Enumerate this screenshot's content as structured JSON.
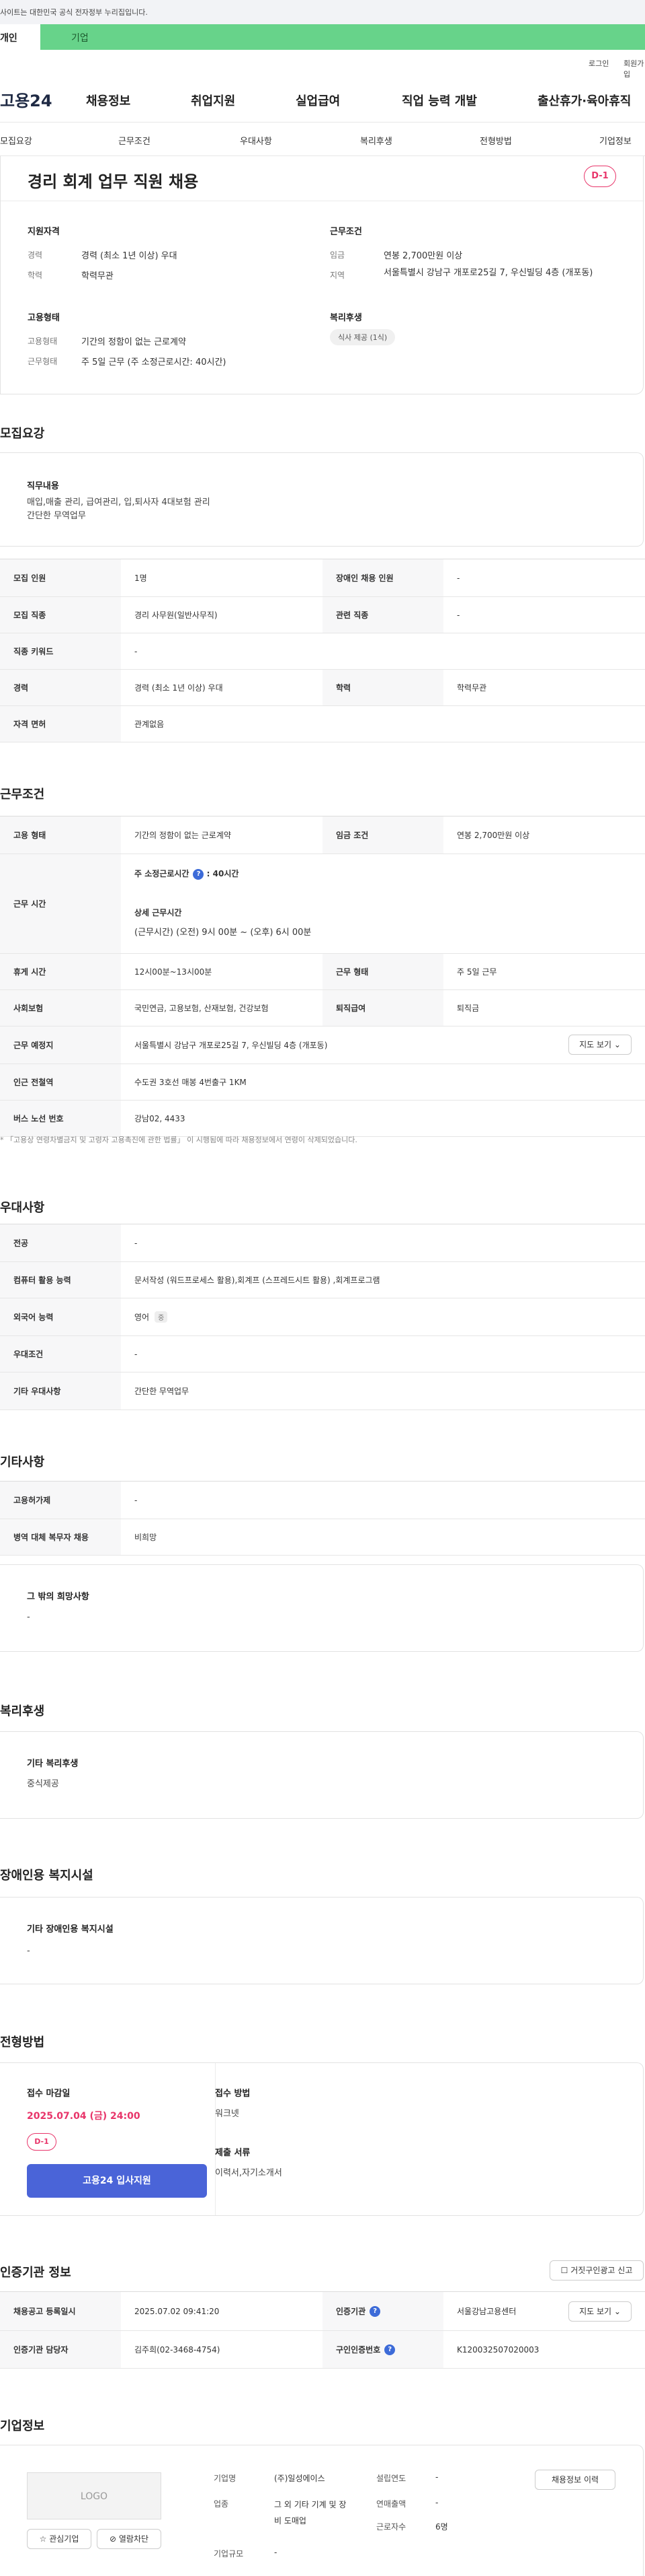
{
  "gov_banner": {
    "text": "사이트는 대한민국 공식 전자정부 누리집입니다."
  },
  "tabs": {
    "person": "개인",
    "company": "기업"
  },
  "util": {
    "login": "로그인",
    "join": "회원가입"
  },
  "gnb": {
    "logo": "고용24",
    "menus": [
      "채용정보",
      "취업지원",
      "실업급여",
      "직업 능력 개발",
      "출산휴가·육아휴직"
    ]
  },
  "subnav": [
    "모집요강",
    "근무조건",
    "우대사항",
    "복리후생",
    "전형방법",
    "기업정보"
  ],
  "header": {
    "job_title": "경리 회계 업무 직원 채용",
    "dday": "D-1"
  },
  "summary": {
    "qual_title": "지원자격",
    "qual": [
      {
        "k": "경력",
        "v": "경력 (최소 1년 이상) 우대"
      },
      {
        "k": "학력",
        "v": "학력무관"
      }
    ],
    "cond_title": "근무조건",
    "cond": [
      {
        "k": "임금",
        "v": "연봉 2,700만원 이상"
      },
      {
        "k": "지역",
        "v": "서울특별시 강남구 개포로25길 7, 우신빌딩 4층 (개포동)"
      }
    ],
    "emp_title": "고용형태",
    "emp": [
      {
        "k": "고용형태",
        "v": "기간의 정함이 없는 근로계약"
      },
      {
        "k": "근무형태",
        "v": "주 5일 근무 (주 소정근로시간: 40시간)"
      }
    ],
    "welfare_title": "복리후생",
    "welfare_chip": "식사 제공 (1식)"
  },
  "recruit": {
    "title": "모집요강",
    "duty_title": "직무내용",
    "duty_text": "매입,매출 관리, 급여관리, 입,퇴사자 4대보험 관리\n간단한 무역업무",
    "rows": [
      {
        "k1": "모집 인원",
        "v1": "1명",
        "k2": "장애인 채용 인원",
        "v2": "-"
      },
      {
        "k1": "모집 직종",
        "v1": "경리 사무원(일반사무직)",
        "k2": "관련 직종",
        "v2": "-"
      },
      {
        "k1": "직종 키워드",
        "v1": "-"
      },
      {
        "k1": "경력",
        "v1": "경력 (최소 1년 이상) 우대",
        "k2": "학력",
        "v2": "학력무관"
      },
      {
        "k1": "자격 면허",
        "v1": "관계없음"
      }
    ]
  },
  "conditions": {
    "title": "근무조건",
    "emp_type": {
      "k1": "고용 형태",
      "v1": "기간의 정함이 없는 근로계약",
      "k2": "임금 조건",
      "v2": "연봉 2,700만원 이상"
    },
    "hours": {
      "k": "근무 시간",
      "weekly_label": "주 소정근로시간",
      "weekly_value": ": 40시간",
      "detail_label": "상세 근무시간",
      "detail_value": "(근무시간) (오전) 9시 00분 ~ (오후) 6시 00분"
    },
    "rest": {
      "k1": "휴게 시간",
      "v1": "12시00분~13시00분",
      "k2": "근무 형태",
      "v2": "주 5일 근무"
    },
    "insurance": {
      "k1": "사회보험",
      "v1": "국민연금, 고용보험, 산재보험, 건강보험",
      "k2": "퇴직급여",
      "v2": "퇴직금"
    },
    "place": {
      "k": "근무 예정지",
      "v": "서울특별시 강남구 개포로25길 7, 우신빌딩 4층 (개포동)",
      "btn": "지도 보기"
    },
    "subway": {
      "k": "인근 전철역",
      "v": "수도권 3호선 매봉 4번출구 1KM"
    },
    "bus": {
      "k": "버스 노선 번호",
      "v": "강남02, 4433"
    },
    "note": "* 「고용상 연령차별금지 및 고령자 고용촉진에 관한 법률」 이 시행됨에 따라 채용정보에서 연령이 삭제되었습니다."
  },
  "preference": {
    "title": "우대사항",
    "rows": [
      {
        "k": "전공",
        "v": "-"
      },
      {
        "k": "컴퓨터 활용 능력",
        "v": "문서작성 (워드프로세스 활용),회계프 (스프레드시트 활용) ,회계프로그램"
      },
      {
        "k": "외국어 능력",
        "v": "영어",
        "badge": "중"
      },
      {
        "k": "우대조건",
        "v": "-"
      },
      {
        "k": "기타 우대사항",
        "v": "간단한 무역업무"
      }
    ]
  },
  "etc": {
    "title": "기타사항",
    "rows": [
      {
        "k": "고용허가제",
        "v": "-"
      },
      {
        "k": "병역 대체 복무자 채용",
        "v": "비희망"
      }
    ],
    "hope_title": "그 밖의 희망사항",
    "hope_text": "-"
  },
  "welfare": {
    "title": "복리후생",
    "box_title": "기타 복리후생",
    "box_text": "중식제공"
  },
  "disability": {
    "title": "장애인용 복지시설",
    "box_title": "기타 장애인용 복지시설",
    "box_text": "-"
  },
  "selection": {
    "title": "전형방법",
    "deadline_label": "접수 마감일",
    "deadline": "2025.07.04 (금) 24:00",
    "dday": "D-1",
    "apply": "고용24 입사지원",
    "method_label": "접수 방법",
    "method": "워크넷",
    "docs_label": "제출 서류",
    "docs": "이력서,자기소개서"
  },
  "cert": {
    "title": "인증기관 정보",
    "report_btn": "거짓구인광고 신고",
    "r1": {
      "k1": "채용공고 등록일시",
      "v1": "2025.07.02 09:41:20",
      "k2": "인증기관",
      "v2": "서울강남고용센터",
      "btn": "지도 보기"
    },
    "r2": {
      "k1": "인증기관 담당자",
      "v1": "김주희(02-3468-4754)",
      "k2": "구인인증번호",
      "v2": "K120032507020003"
    }
  },
  "company": {
    "title": "기업정보",
    "logo": "LOGO",
    "interest": "관심기업",
    "block": "열람차단",
    "history_btn": "채용정보 이력",
    "fields": [
      {
        "k": "기업명",
        "v": "(주)일성에이스"
      },
      {
        "k": "업종",
        "v": "그 외 기타 기계 및 장비 도매업"
      },
      {
        "k": "기업규모",
        "v": "-"
      }
    ],
    "fields2": [
      {
        "k": "설립연도",
        "v": "-"
      },
      {
        "k": "연매출액",
        "v": "-"
      },
      {
        "k": "근로자수",
        "v": "6명"
      }
    ]
  },
  "colors": {
    "accent": "#4a64d8",
    "dday": "#e8356a",
    "company_tab": "#67d38a"
  }
}
